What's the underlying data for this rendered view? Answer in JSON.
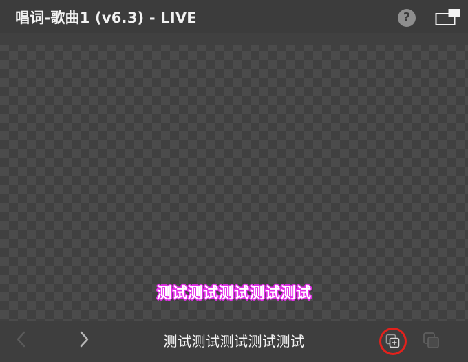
{
  "window": {
    "title": "唱词-歌曲1 (v6.3) - LIVE"
  },
  "titlebar": {
    "help_label": "?",
    "help_icon": "question-circle-icon",
    "popout_icon": "popout-window-icon"
  },
  "preview": {
    "lyric_text": "测试测试测试测试测试",
    "text_color": "#ffffff",
    "outline_color": "#e22ce8"
  },
  "bottombar": {
    "prev_icon": "chevron-left-icon",
    "next_icon": "chevron-right-icon",
    "current_line": "测试测试测试测试测试",
    "add_icon": "add-layer-icon",
    "add_highlight_color": "#e3211c",
    "layers_icon": "duplicate-layer-icon"
  }
}
